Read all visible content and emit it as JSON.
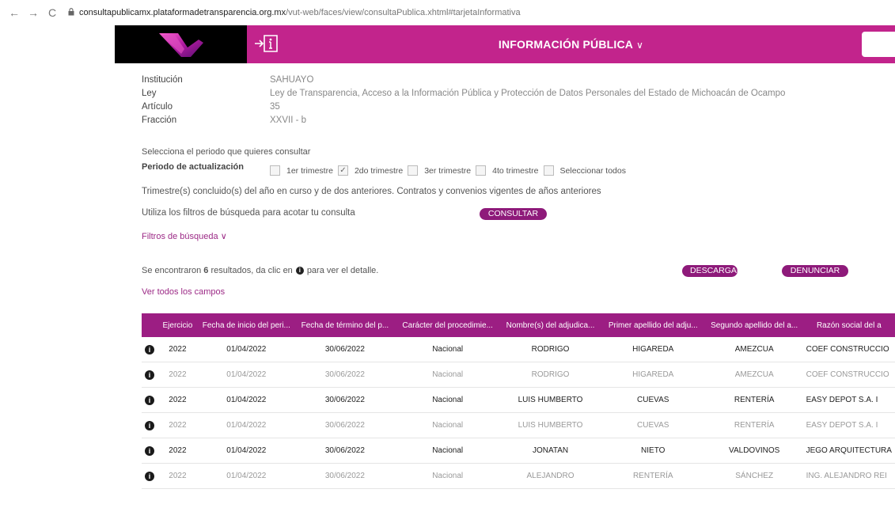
{
  "browser": {
    "back": "←",
    "forward": "→",
    "reload": "C",
    "url_host": "consultapublicamx.plataformadetransparencia.org.mx",
    "url_path": "/vut-web/faces/view/consultaPublica.xhtml#tarjetaInformativa"
  },
  "header": {
    "title": "INFORMACIÓN PÚBLICA",
    "chevron": "∨"
  },
  "info": [
    {
      "label": "Institución",
      "value": "SAHUAYO"
    },
    {
      "label": "Ley",
      "value": "Ley de Transparencia, Acceso a la Información Pública y Protección de Datos Personales del Estado de Michoacán de Ocampo"
    },
    {
      "label": "Artículo",
      "value": "35"
    },
    {
      "label": "Fracción",
      "value": "XXVII - b"
    }
  ],
  "periodo": {
    "prompt": "Selecciona el periodo que quieres consultar",
    "label": "Periodo de actualización",
    "options": [
      {
        "label": "1er trimestre",
        "checked": false
      },
      {
        "label": "2do trimestre",
        "checked": true
      },
      {
        "label": "3er trimestre",
        "checked": false
      },
      {
        "label": "4to trimestre",
        "checked": false
      },
      {
        "label": "Seleccionar todos",
        "checked": false
      }
    ]
  },
  "nota": "Trimestre(s) concluido(s) del año en curso y de dos anteriores. Contratos y convenios vigentes de años anteriores",
  "filtros_texto": "Utiliza los filtros de búsqueda para acotar tu consulta",
  "consultar_label": "CONSULTAR",
  "filtros_link": "Filtros de búsqueda",
  "filtros_chevron": "∨",
  "resultados": {
    "pre": "Se encontraron",
    "count": "6",
    "mid": "resultados, da clic en",
    "post": "para ver el detalle."
  },
  "descargar_label": "DESCARGAR",
  "denunciar_label": "DENUNCIAR",
  "ver_todos": "Ver todos los campos",
  "table": {
    "headers": [
      "",
      "Ejercicio",
      "Fecha de inicio del peri...",
      "Fecha de término del p...",
      "Carácter del procedimie...",
      "Nombre(s) del adjudica...",
      "Primer apellido del adju...",
      "Segundo apellido del a...",
      "Razón social del a"
    ],
    "rows": [
      [
        "2022",
        "01/04/2022",
        "30/06/2022",
        "Nacional",
        "RODRIGO",
        "HIGAREDA",
        "AMEZCUA",
        "COEF CONSTRUCCIO"
      ],
      [
        "2022",
        "01/04/2022",
        "30/06/2022",
        "Nacional",
        "RODRIGO",
        "HIGAREDA",
        "AMEZCUA",
        "COEF CONSTRUCCIO"
      ],
      [
        "2022",
        "01/04/2022",
        "30/06/2022",
        "Nacional",
        "LUIS HUMBERTO",
        "CUEVAS",
        "RENTERÍA",
        "EASY DEPOT S.A. I"
      ],
      [
        "2022",
        "01/04/2022",
        "30/06/2022",
        "Nacional",
        "LUIS HUMBERTO",
        "CUEVAS",
        "RENTERÍA",
        "EASY DEPOT S.A. I"
      ],
      [
        "2022",
        "01/04/2022",
        "30/06/2022",
        "Nacional",
        "JONATAN",
        "NIETO",
        "VALDOVINOS",
        "JEGO ARQUITECTURA"
      ],
      [
        "2022",
        "01/04/2022",
        "30/06/2022",
        "Nacional",
        "ALEJANDRO",
        "RENTERÍA",
        "SÁNCHEZ",
        "ING. ALEJANDRO REI"
      ]
    ]
  },
  "colors": {
    "accent": "#c2248c",
    "table_header": "#9c1e83",
    "button": "#8e1a7a"
  }
}
